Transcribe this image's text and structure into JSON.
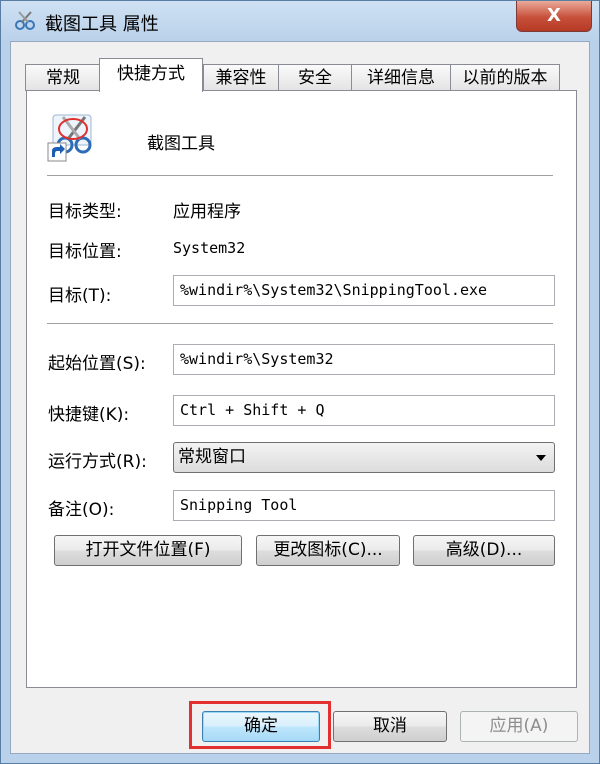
{
  "window": {
    "title": "截图工具 属性",
    "close_label": "X"
  },
  "tabs": [
    {
      "label": "常规"
    },
    {
      "label": "快捷方式"
    },
    {
      "label": "兼容性"
    },
    {
      "label": "安全"
    },
    {
      "label": "详细信息"
    },
    {
      "label": "以前的版本"
    }
  ],
  "shortcut": {
    "name": "截图工具",
    "target_type_label": "目标类型:",
    "target_type_value": "应用程序",
    "target_location_label": "目标位置:",
    "target_location_value": "System32",
    "target_label": "目标(T):",
    "target_value": "%windir%\\System32\\SnippingTool.exe",
    "start_in_label": "起始位置(S):",
    "start_in_value": "%windir%\\System32",
    "hotkey_label": "快捷键(K):",
    "hotkey_value": "Ctrl + Shift + Q",
    "run_label": "运行方式(R):",
    "run_value": "常规窗口",
    "comment_label": "备注(O):",
    "comment_value": "Snipping Tool",
    "open_location_button": "打开文件位置(F)",
    "change_icon_button": "更改图标(C)...",
    "advanced_button": "高级(D)..."
  },
  "footer": {
    "ok": "确定",
    "cancel": "取消",
    "apply": "应用(A)"
  }
}
